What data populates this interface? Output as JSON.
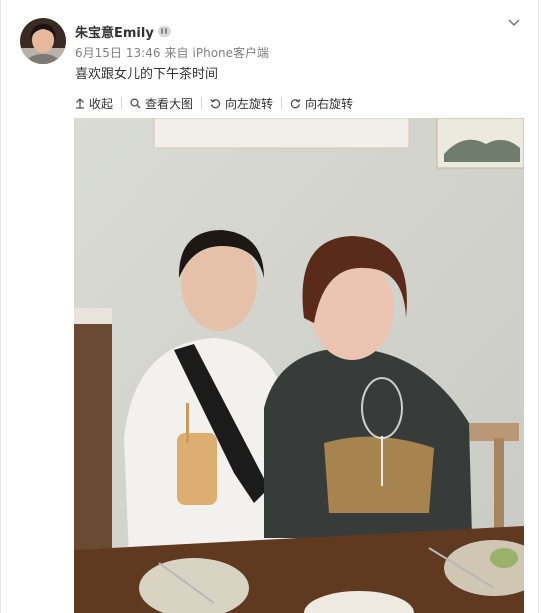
{
  "post": {
    "author_name": "朱宝意Emily",
    "date": "6月15日",
    "time": "13:46",
    "source_prefix": "来自",
    "source": "iPhone客户端",
    "text": "喜欢跟女儿的下午茶时间"
  },
  "toolbar": {
    "collapse": "收起",
    "view_large": "查看大图",
    "rotate_left": "向左旋转",
    "rotate_right": "向右旋转"
  },
  "icons": {
    "collapse": "arrow-up-icon",
    "view_large": "magnifier-icon",
    "rotate_left": "rotate-left-icon",
    "rotate_right": "rotate-right-icon",
    "more": "chevron-down-icon",
    "badge": "verified-badge-icon"
  },
  "colors": {
    "text": "#333333",
    "meta": "#808080",
    "border": "#e6e6e6"
  }
}
